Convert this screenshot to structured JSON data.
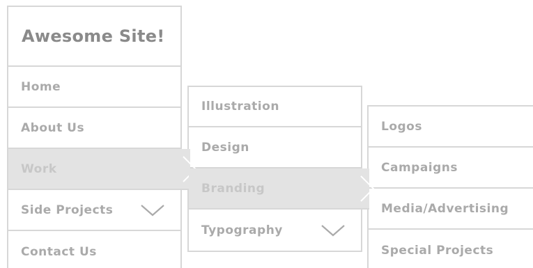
{
  "site": {
    "title": "Awesome Site!"
  },
  "main_menu": {
    "items": [
      {
        "label": "Home"
      },
      {
        "label": "About Us"
      },
      {
        "label": "Work"
      },
      {
        "label": "Side Projects"
      },
      {
        "label": "Contact Us"
      }
    ]
  },
  "work_menu": {
    "items": [
      {
        "label": "Illustration"
      },
      {
        "label": "Design"
      },
      {
        "label": "Branding"
      },
      {
        "label": "Typography"
      }
    ]
  },
  "branding_menu": {
    "items": [
      {
        "label": "Logos"
      },
      {
        "label": "Campaigns"
      },
      {
        "label": "Media/Advertising"
      },
      {
        "label": "Special Projects"
      }
    ]
  },
  "colors": {
    "border": "#d7d7d7",
    "active_bg": "#e3e3e3",
    "text": "#aaaaaa",
    "title_text": "#8a8a8a"
  },
  "icons": {
    "expand": "chevron-down-icon",
    "submenu": "chevron-right-icon"
  }
}
